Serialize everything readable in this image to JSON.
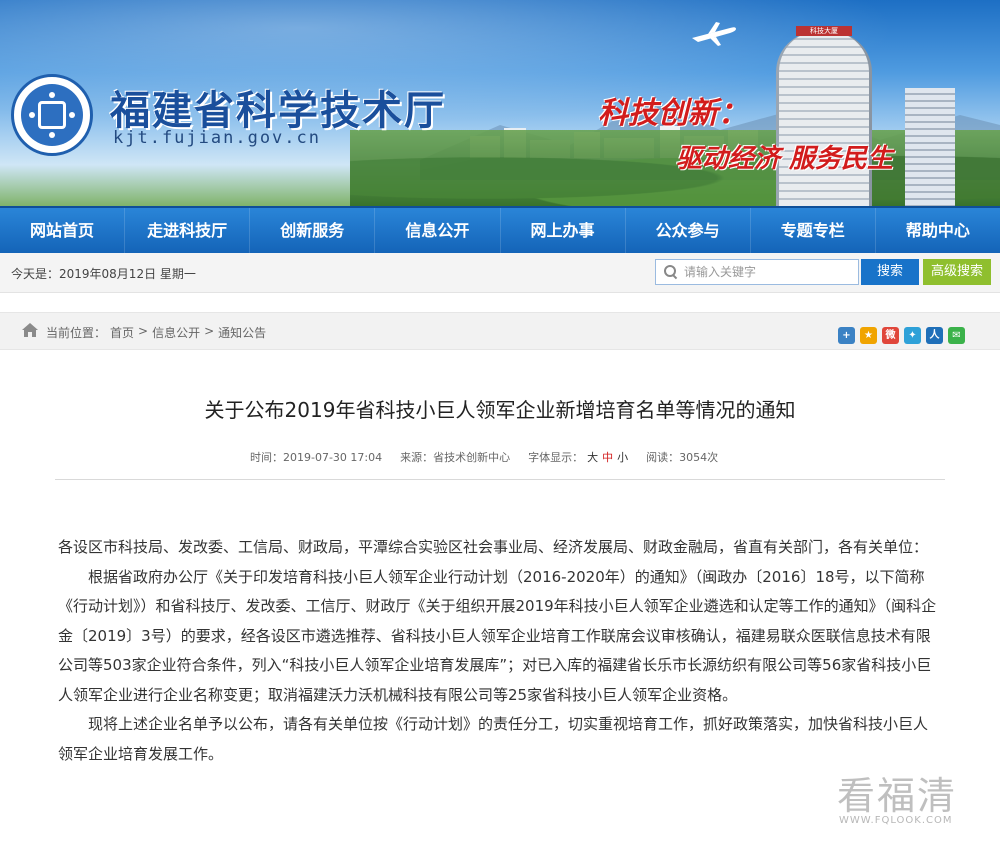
{
  "header": {
    "site_title": "福建省科学技术厅",
    "site_domain": "kjt.fujian.gov.cn",
    "slogan_line1": "科技创新：",
    "slogan_line2": "驱动经济 服务民生",
    "tower_sign": "科技大厦",
    "logo_icon": "fujian-science-emblem-icon"
  },
  "nav": {
    "items": [
      {
        "label": "网站首页"
      },
      {
        "label": "走进科技厅"
      },
      {
        "label": "创新服务"
      },
      {
        "label": "信息公开"
      },
      {
        "label": "网上办事"
      },
      {
        "label": "公众参与"
      },
      {
        "label": "专题专栏"
      },
      {
        "label": "帮助中心"
      }
    ]
  },
  "infobar": {
    "date_text": "今天是：2019年08月12日 星期一",
    "search_placeholder": "请输入关键字",
    "search_button": "搜索",
    "advanced_search_button": "高级搜索"
  },
  "breadcrumb": {
    "prefix": "当前位置：",
    "items": [
      "首页",
      "信息公开",
      "通知公告"
    ],
    "separator": ">"
  },
  "share_icons": [
    {
      "name": "plus-share-icon",
      "glyph": "+",
      "color": "#3b82c4"
    },
    {
      "name": "qzone-share-icon",
      "glyph": "★",
      "color": "#f0a400"
    },
    {
      "name": "weibo-share-icon",
      "glyph": "微",
      "color": "#e0463a"
    },
    {
      "name": "tencent-weibo-share-icon",
      "glyph": "✦",
      "color": "#2ea1d8"
    },
    {
      "name": "renren-share-icon",
      "glyph": "人",
      "color": "#1f6fb8"
    },
    {
      "name": "wechat-share-icon",
      "glyph": "✉",
      "color": "#3bb24a"
    }
  ],
  "article": {
    "title": "关于公布2019年省科技小巨人领军企业新增培育名单等情况的通知",
    "meta_time": "时间：2019-07-30 17:04",
    "meta_source": "来源：省技术创新中心",
    "meta_font_label": "字体显示：",
    "font_large": "大",
    "font_mid": "中",
    "font_small": "小",
    "meta_views": "阅读：3054次",
    "para1": "各设区市科技局、发改委、工信局、财政局，平潭综合实验区社会事业局、经济发展局、财政金融局，省直有关部门，各有关单位：",
    "para2": "根据省政府办公厅《关于印发培育科技小巨人领军企业行动计划（2016-2020年）的通知》（闽政办〔2016〕18号，以下简称《行动计划》）和省科技厅、发改委、工信厅、财政厅《关于组织开展2019年科技小巨人领军企业遴选和认定等工作的通知》（闽科企金〔2019〕3号）的要求，经各设区市遴选推荐、省科技小巨人领军企业培育工作联席会议审核确认，福建易联众医联信息技术有限公司等503家企业符合条件，列入“科技小巨人领军企业培育发展库”；对已入库的福建省长乐市长源纺织有限公司等56家省科技小巨人领军企业进行企业名称变更；取消福建沃力沃机械科技有限公司等25家省科技小巨人领军企业资格。",
    "para3": "现将上述企业名单予以公布，请各有关单位按《行动计划》的责任分工，切实重视培育工作，抓好政策落实，加快省科技小巨人领军企业培育发展工作。"
  },
  "watermark": {
    "title": "看福清",
    "url": "WWW.FQLOOK.COM"
  }
}
